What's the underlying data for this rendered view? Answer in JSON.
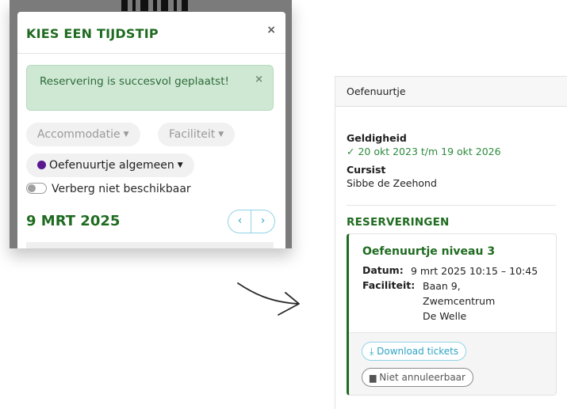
{
  "modal": {
    "title": "KIES EEN TIJDSTIP",
    "close_label": "×",
    "alert": {
      "text": "Reservering is succesvol geplaatst!",
      "close_label": "×"
    },
    "filters": {
      "accommodatie": "Accommodatie",
      "faciliteit": "Faciliteit",
      "activity": "Oefenuurtje algemeen",
      "activity_color": "#5a1790"
    },
    "toggle_label": "Verberg niet beschikbaar",
    "date": "9 MRT 2025",
    "prev_label": "‹",
    "next_label": "›"
  },
  "panel": {
    "header": "Oefenuurtje",
    "geldigheid_label": "Geldigheid",
    "geldigheid_value": "✓ 20 okt 2023 t/m 19 okt 2026",
    "cursist_label": "Cursist",
    "cursist_value": "Sibbe de Zeehond",
    "reserveringen_title": "RESERVERINGEN",
    "reservation": {
      "title": "Oefenuurtje niveau 3",
      "datum_label": "Datum:",
      "datum_value": "9 mrt 2025 10:15 – 10:45",
      "faciliteit_label": "Faciliteit:",
      "faciliteit_value": "Baan 9, Zwemcentrum De Welle",
      "download_label": "⤓ Download tickets",
      "cancel_label": "Niet annuleerbaar"
    }
  },
  "colors": {
    "brand_green": "#1f6b20",
    "accent_blue": "#2ea4c4",
    "success_bg": "#cfe8d3"
  }
}
